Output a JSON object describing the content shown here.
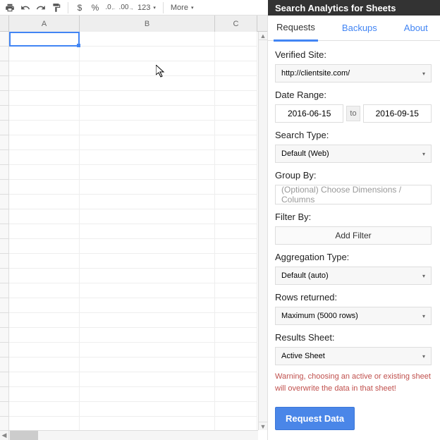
{
  "toolbar": {
    "currency": "$",
    "percent": "%",
    "dec_decrease": ".0",
    "dec_increase": ".00",
    "format123": "123",
    "more": "More"
  },
  "columns": {
    "A": "A",
    "B": "B",
    "C": "C"
  },
  "panel": {
    "title": "Search Analytics for Sheets",
    "tabs": {
      "requests": "Requests",
      "backups": "Backups",
      "about": "About"
    },
    "verified_site_label": "Verified Site:",
    "verified_site_value": "http://clientsite.com/",
    "date_range_label": "Date Range:",
    "date_from": "2016-06-15",
    "date_to_label": "to",
    "date_to": "2016-09-15",
    "search_type_label": "Search Type:",
    "search_type_value": "Default (Web)",
    "group_by_label": "Group By:",
    "group_by_placeholder": "(Optional) Choose Dimensions / Columns",
    "filter_by_label": "Filter By:",
    "add_filter": "Add Filter",
    "aggregation_label": "Aggregation Type:",
    "aggregation_value": "Default (auto)",
    "rows_label": "Rows returned:",
    "rows_value": "Maximum (5000 rows)",
    "results_sheet_label": "Results Sheet:",
    "results_sheet_value": "Active Sheet",
    "warning": "Warning, choosing an active or existing sheet will overwrite the data in that sheet!",
    "request_button": "Request Data"
  }
}
